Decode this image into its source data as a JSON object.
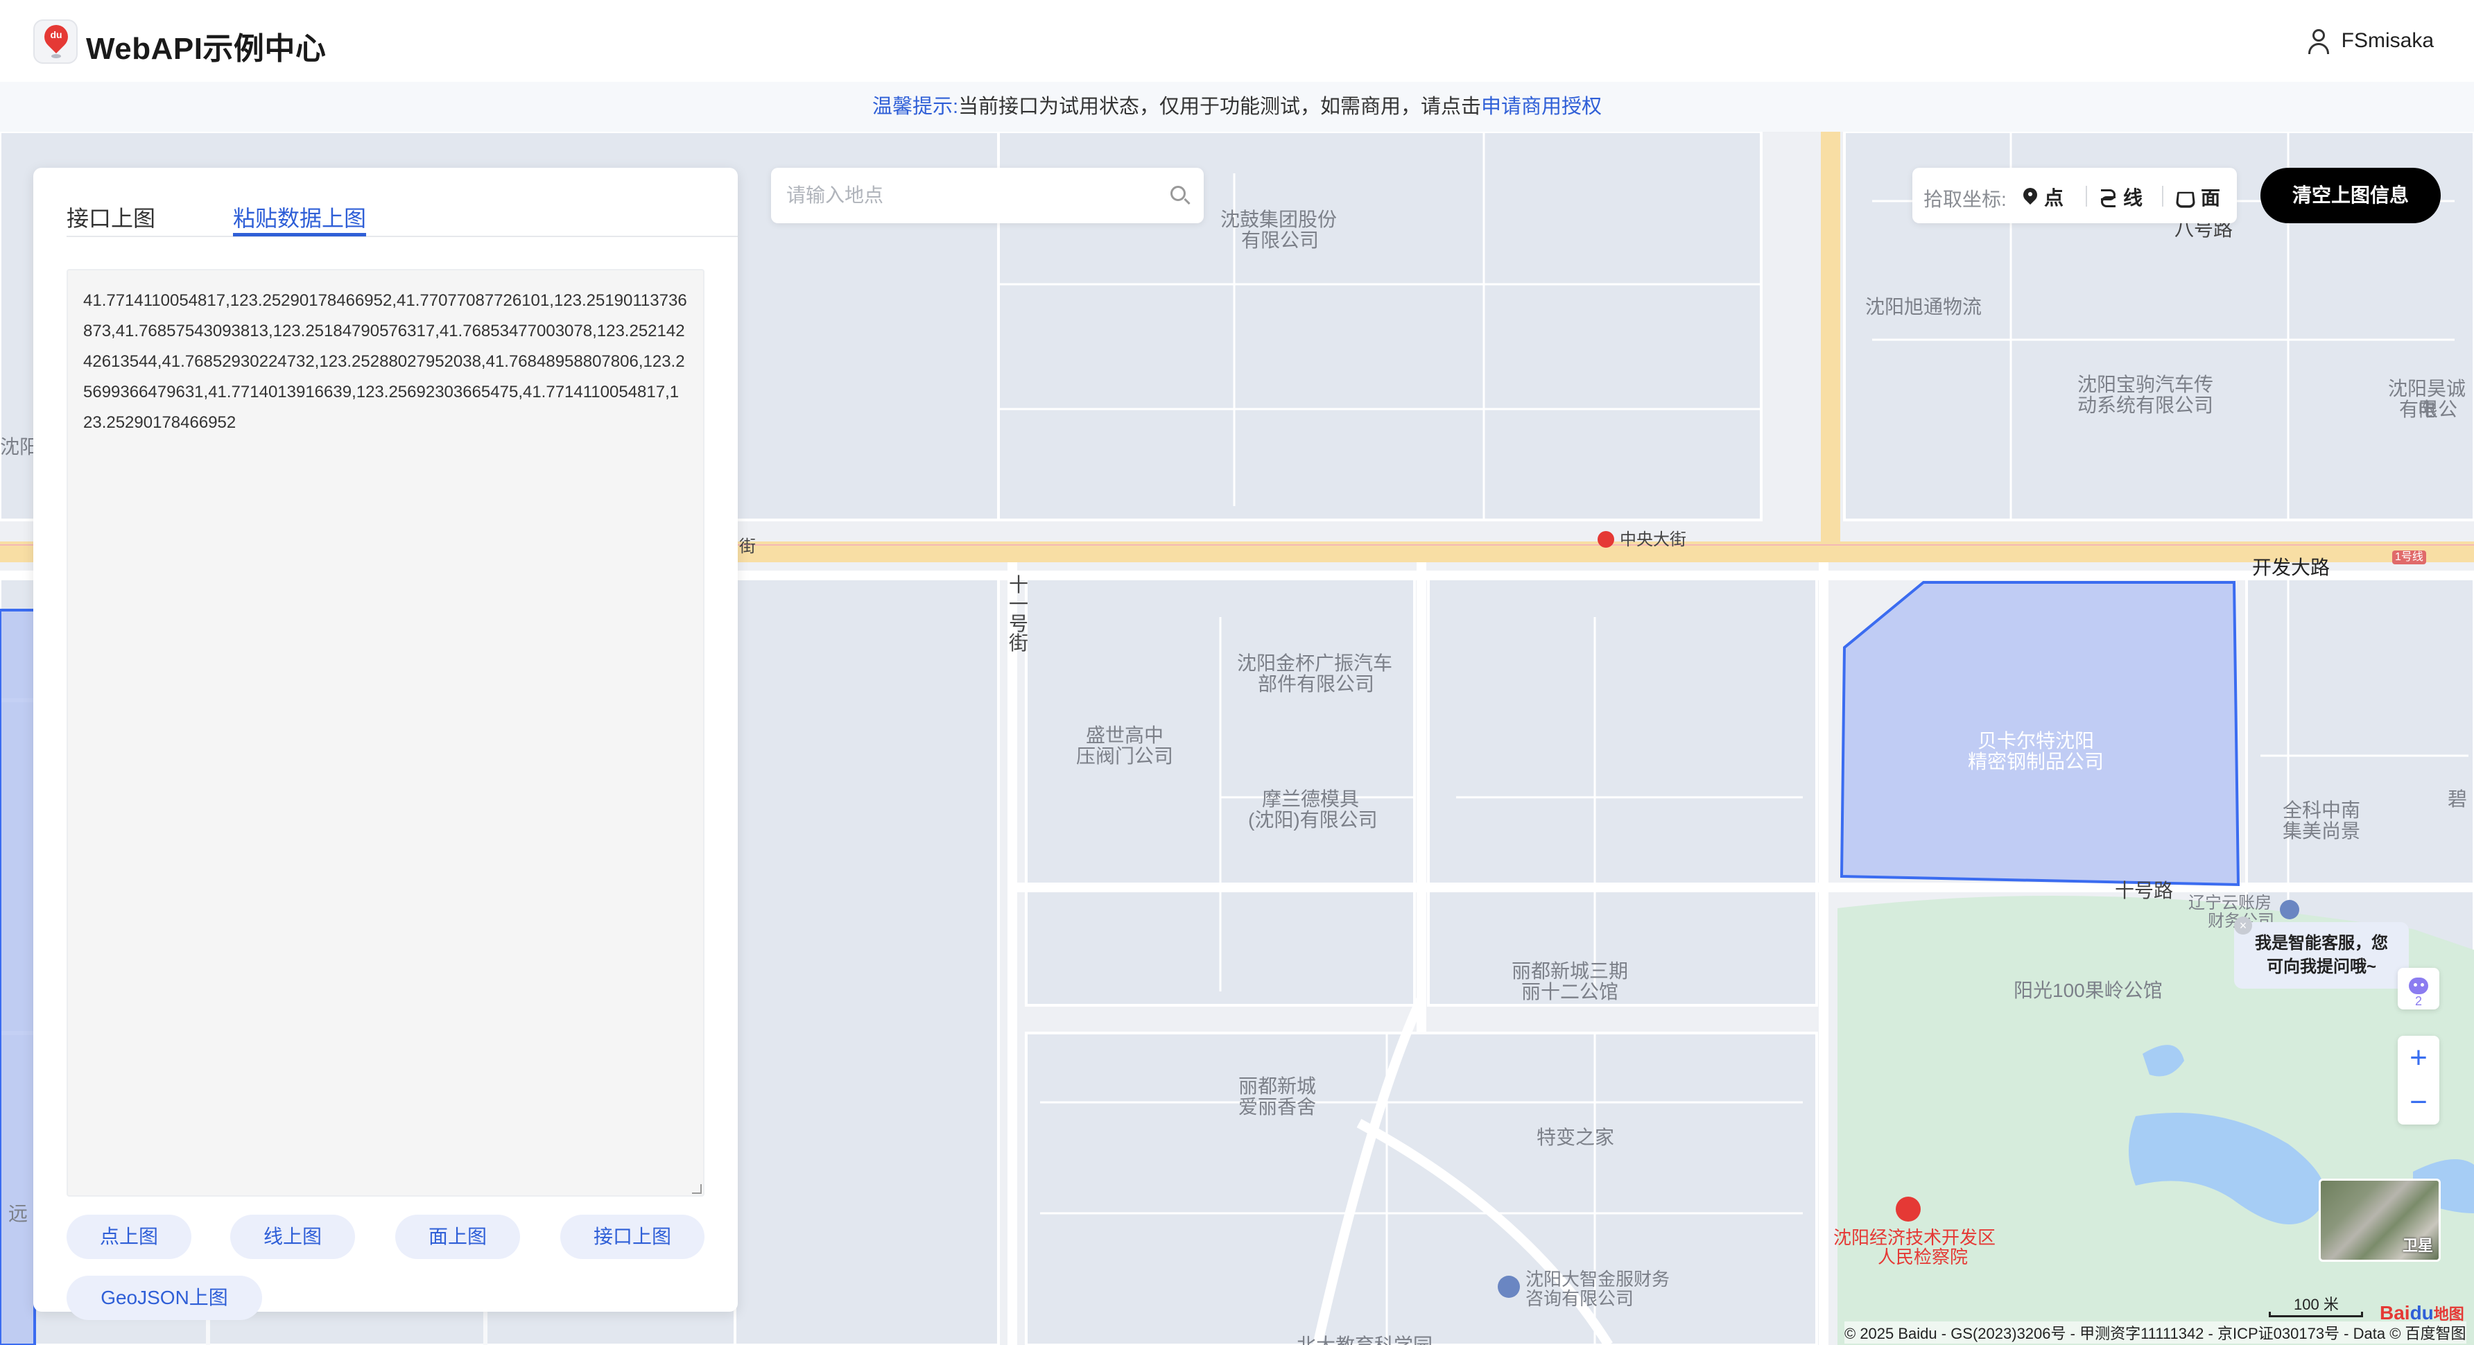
{
  "header": {
    "title": "WebAPI示例中心",
    "logo_text": "du",
    "username": "FSmisaka"
  },
  "notice": {
    "label": "温馨提示:",
    "text": "当前接口为试用状态，仅用于功能测试，如需商用，请点击",
    "link": "申请商用授权"
  },
  "panel": {
    "tabs": [
      {
        "label": "接口上图",
        "active": false
      },
      {
        "label": "粘贴数据上图",
        "active": true
      }
    ],
    "textarea_value": "41.7714110054817,123.25290178466952,41.77077087726101,123.25190113736873,41.76857543093813,123.25184790576317,41.76853477003078,123.25214242613544,41.76852930224732,123.25288027952038,41.76848958807806,123.25699366479631,41.7714013916639,123.25692303665475,41.7714110054817,123.25290178466952",
    "buttons": [
      "点上图",
      "线上图",
      "面上图",
      "接口上图"
    ],
    "geojson_button": "GeoJSON上图"
  },
  "search": {
    "placeholder": "请输入地点"
  },
  "pick": {
    "label": "拾取坐标:",
    "options": [
      "点",
      "线",
      "面"
    ]
  },
  "clear_button": "清空上图信息",
  "assistant": {
    "line1": "我是智能客服，您",
    "line2": "可向我提问哦~",
    "badge": "2",
    "close": "×"
  },
  "zoom": {
    "in": "+",
    "out": "−"
  },
  "satellite_label": "卫星",
  "scale_label": "100 米",
  "baidu_logo": {
    "a": "Bai",
    "b": "du",
    "c": "地图"
  },
  "copyright": "© 2025 Baidu - GS(2023)3206号 - 甲测资字11111342 - 京ICP证030173号 - Data © 百度智图",
  "map_labels": {
    "l01": "沈鼓集团股份",
    "l02": "有限公司",
    "l03": "八号路",
    "l04": "沈阳旭通物流",
    "l05": "沈阳宝驹汽车传",
    "l06": "动系统有限公司",
    "l07": "沈阳昊诚电",
    "l08": "有限公",
    "l09": "沈阳",
    "l10": "中央大街",
    "l11": "街",
    "l12": "开发大路",
    "l13": "1号线",
    "l14": "十一号街",
    "l15": "沈阳金杯广振汽车",
    "l16": "部件有限公司",
    "l17": "盛世高中",
    "l18": "压阀门公司",
    "l19": "摩兰德模具",
    "l20": "(沈阳)有限公司",
    "l21": "贝卡尔特沈阳",
    "l22": "精密钢制品公司",
    "l23": "全科中南",
    "l24": "集美尚景",
    "l25": "碧",
    "l26": "十号路",
    "l27": "辽宁云账房",
    "l28": "财务公司",
    "l29": "丽都新城三期",
    "l30": "丽十二公馆",
    "l31": "阳光100果岭公馆",
    "l32": "丽都新城",
    "l33": "爱丽香舍",
    "l34": "特变之家",
    "l35": "沈阳经济技术开发区",
    "l36": "人民检察院",
    "l37": "沈阳大智金服财务",
    "l38": "咨询有限公司",
    "l39": "北大教育科学园",
    "l40": "远"
  },
  "colors": {
    "accent": "#2f5fd7",
    "polygon_fill": "#b7c6f3",
    "polygon_stroke": "#3b6cf0",
    "road_major": "#f8dfa5",
    "green_area": "#d7eedd",
    "water": "#a7cdf6"
  }
}
